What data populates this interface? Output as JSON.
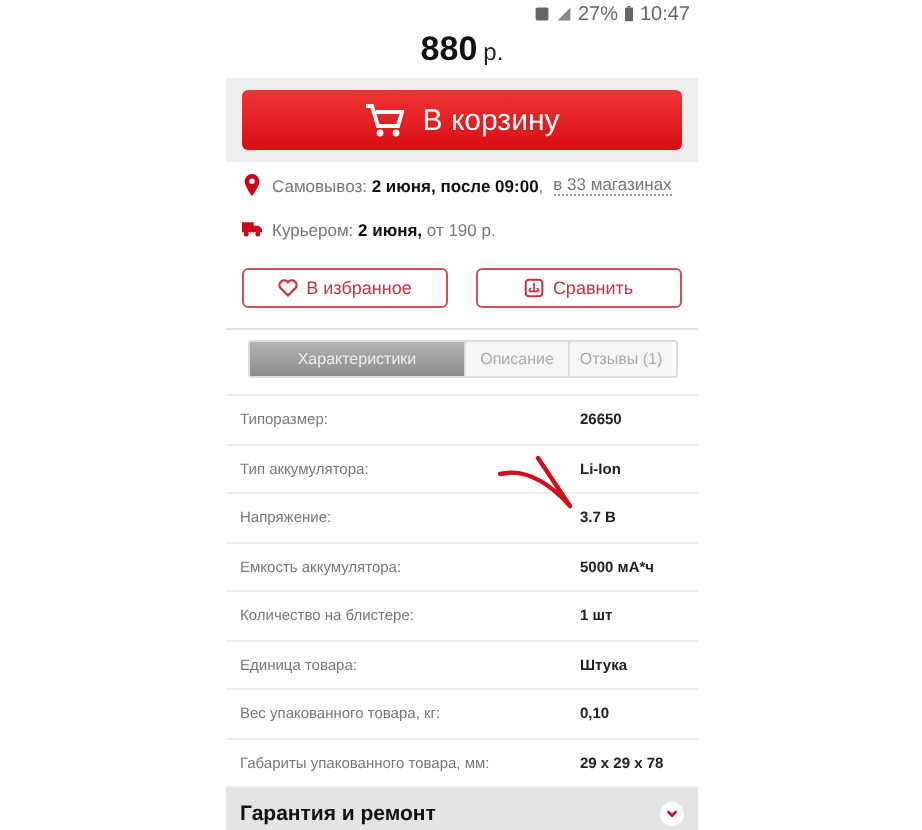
{
  "status_bar": {
    "battery": "27%",
    "time": "10:47"
  },
  "price": {
    "amount": "880",
    "currency": "р."
  },
  "cart_button": {
    "label": "В корзину"
  },
  "delivery": [
    {
      "kind": "pickup",
      "text": "Самовывоз: **2 июня, после 09:00**, ",
      "link": "в 33 магазинах"
    },
    {
      "kind": "courier",
      "text": "Курьером: **2 июня,** от 190 р."
    }
  ],
  "actions": [
    {
      "kind": "favorite",
      "label": "В избранное"
    },
    {
      "kind": "compare",
      "label": "Сравнить"
    }
  ],
  "tabs": [
    {
      "label": "Характеристики",
      "selected": true
    },
    {
      "label": "Описание",
      "selected": false
    },
    {
      "label": "Отзывы (1)",
      "selected": false
    }
  ],
  "specs": [
    {
      "name": "Типоразмер:",
      "value": "26650"
    },
    {
      "name": "Тип аккумулятора:",
      "value": "Li-Ion"
    },
    {
      "name": "Напряжение:",
      "value": "3.7 В"
    },
    {
      "name": "Емкость аккумулятора:",
      "value": "5000 мА*ч"
    },
    {
      "name": "Количество на блистере:",
      "value": "1 шт"
    },
    {
      "name": "Единица товара:",
      "value": "Штука"
    },
    {
      "name": "Вес упакованного товара, кг:",
      "value": "0,10"
    },
    {
      "name": "Габариты упакованного товара, мм:",
      "value": "29 x 29 x 78"
    }
  ],
  "section": {
    "title": "Гарантия и ремонт",
    "expanded": false
  }
}
